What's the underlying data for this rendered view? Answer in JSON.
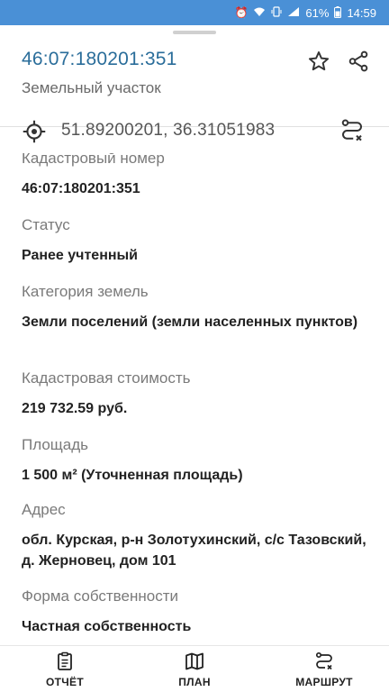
{
  "status_bar": {
    "icons": [
      "alarm-icon",
      "wifi-icon",
      "vibrate-icon",
      "signal-icon"
    ],
    "battery": "61%",
    "time": "14:59"
  },
  "header": {
    "title": "46:07:180201:351",
    "subtitle": "Земельный участок"
  },
  "coordinates": {
    "text": "51.89200201, 36.31051983"
  },
  "fields": [
    {
      "label": "Кадастровый номер",
      "value": "46:07:180201:351"
    },
    {
      "label": "Статус",
      "value": "Ранее учтенный"
    },
    {
      "label": "Категория земель",
      "value": "Земли поселений (земли населенных пунктов)"
    },
    {
      "label": "Кадастровая стоимость",
      "value": "219 732.59 руб."
    },
    {
      "label": "Площадь",
      "value": "1 500 м² (Уточненная площадь)"
    },
    {
      "label": "Адрес",
      "value": "обл. Курская, р-н Золотухинский, с/с Тазовский, д. Жерновец, дом 101"
    },
    {
      "label": "Форма собственности",
      "value": "Частная собственность"
    }
  ],
  "bottom_nav": [
    {
      "label": "ОТЧЁТ",
      "icon": "report-icon"
    },
    {
      "label": "ПЛАН",
      "icon": "map-icon"
    },
    {
      "label": "МАРШРУТ",
      "icon": "route-icon"
    }
  ],
  "colors": {
    "status_bar": "#4a90d6",
    "title": "#2a6d9a",
    "label": "#7a7a7a"
  }
}
